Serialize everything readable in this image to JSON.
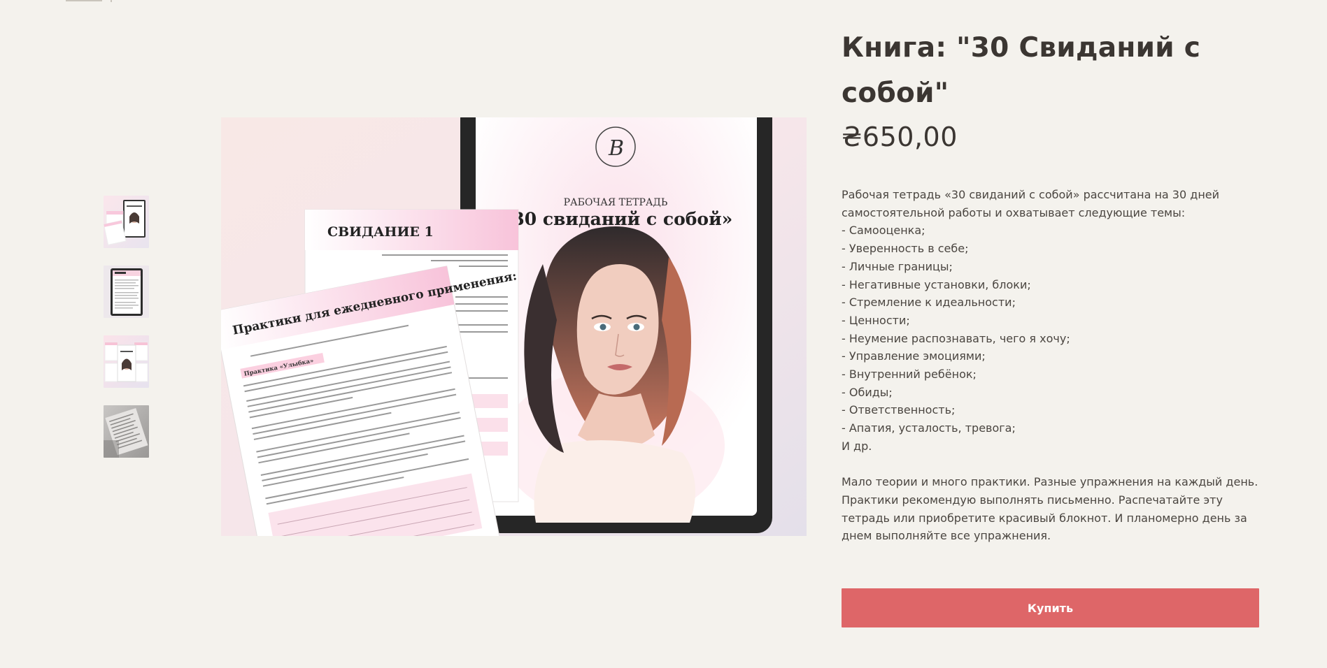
{
  "product": {
    "title": "Книга: \"30 Свиданий с собой\"",
    "price": "₴650,00",
    "description_intro": [
      "Рабочая тетрадь «30 свиданий с собой» рассчитана на 30 дней",
      "самостоятельной работы и охватывает следующие темы:"
    ],
    "topics": [
      "- Самооценка;",
      "- Уверенность в себе;",
      "- Личные границы;",
      "- Негативные установки, блоки;",
      "- Стремление к идеальности;",
      "- Ценности;",
      "- Неумение распознавать, чего я хочу;",
      "- Управление эмоциями;",
      "- Внутренний ребёнок;",
      "- Обиды;",
      "- Ответственность;",
      "- Апатия, усталость, тревога;",
      "И др."
    ],
    "description_outro": [
      "Мало теории и много практики. Разные упражнения на каждый день.",
      "Практики рекомендую выполнять письменно. Распечатайте эту",
      "тетрадь или приобретите красивый блокнот. И планомерно день за",
      "днем выполняйте все упражнения."
    ],
    "buy_label": "Купить"
  },
  "gallery": {
    "main_image": {
      "cover_subtitle": "РАБОЧАЯ ТЕТРАДЬ",
      "cover_title": "«30 свиданий с собой»",
      "page1_heading": "СВИДАНИЕ 1",
      "page2_heading": "Практики для ежедневного применения:",
      "page2_section": "Практика «Улыбка»"
    },
    "thumbnails": [
      "thumbnail-1",
      "thumbnail-2",
      "thumbnail-3",
      "thumbnail-4"
    ]
  },
  "colors": {
    "background": "#f4f2ed",
    "text": "#3b3632",
    "buy_button": "#de6668",
    "accent_pink": "#f5c6d6"
  }
}
